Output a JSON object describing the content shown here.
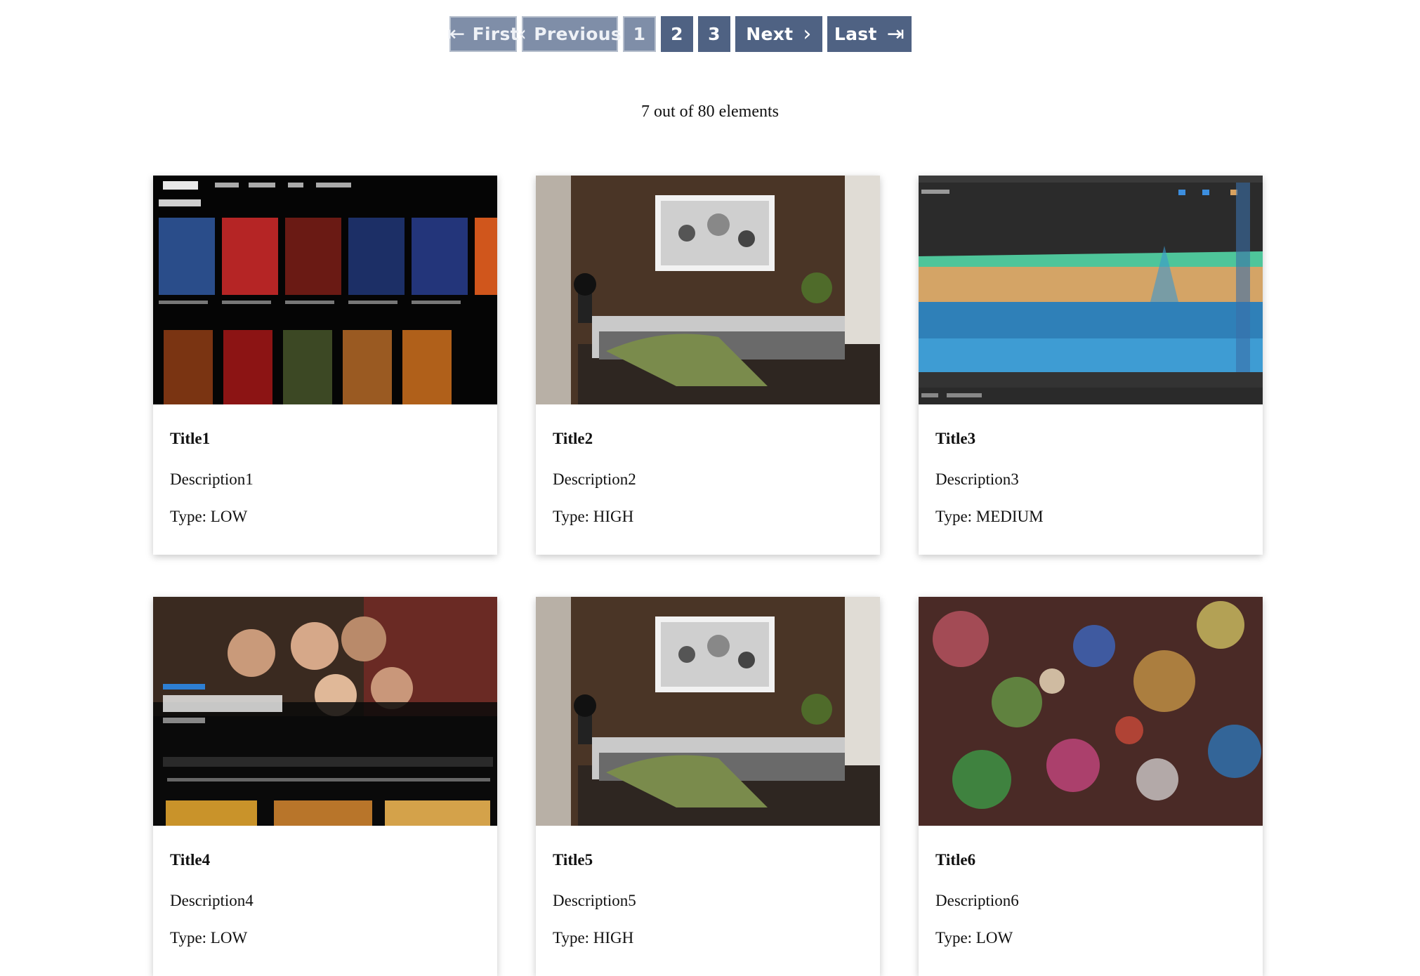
{
  "pagination": {
    "first_label": "First",
    "previous_label": "Previous",
    "pages": [
      "1",
      "2",
      "3"
    ],
    "current_page": "1",
    "next_label": "Next",
    "last_label": "Last"
  },
  "summary": {
    "count_text": "7 out of 80 elements"
  },
  "cards": [
    {
      "title": "Title1",
      "description": "Description1",
      "type": "Type: LOW",
      "image": "streaming-app-star-wars-screenshot"
    },
    {
      "title": "Title2",
      "description": "Description2",
      "type": "Type: HIGH",
      "image": "bedroom-interior-photo"
    },
    {
      "title": "Title3",
      "description": "Description3",
      "type": "Type: MEDIUM",
      "image": "memory-profiler-chart-screenshot"
    },
    {
      "title": "Title4",
      "description": "Description4",
      "type": "Type: LOW",
      "image": "streaming-app-friends-screenshot"
    },
    {
      "title": "Title5",
      "description": "Description5",
      "type": "Type: HIGH",
      "image": "bedroom-interior-photo"
    },
    {
      "title": "Title6",
      "description": "Description6",
      "type": "Type: LOW",
      "image": "glitter-bokeh-photo"
    }
  ],
  "colors": {
    "button": "#4f6283",
    "button_disabled": "#7f8ea8"
  }
}
